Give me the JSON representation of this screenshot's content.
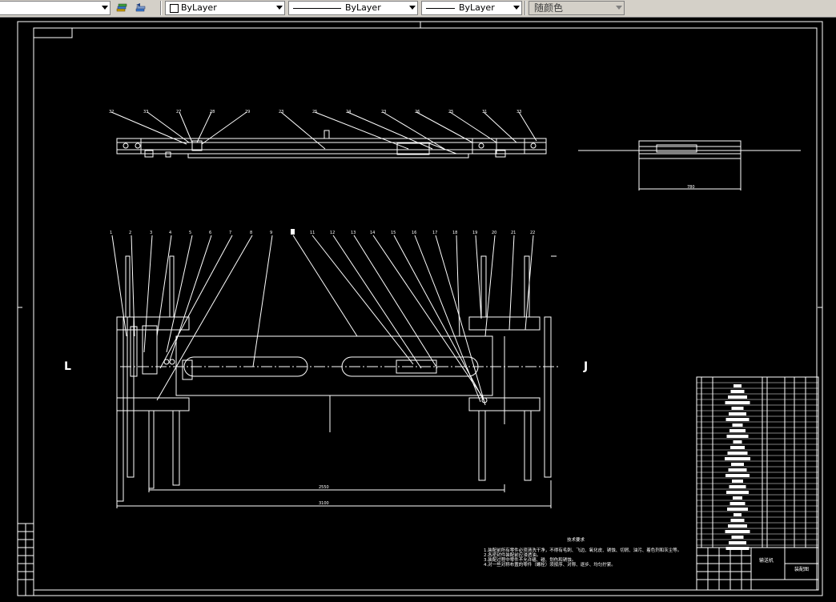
{
  "toolbar": {
    "layer_icon_1": "layer-states-icon",
    "layer_icon_2": "layer-previous-icon",
    "color_combo": "ByLayer",
    "linetype_combo": "ByLayer",
    "lineweight_combo": "ByLayer",
    "plotstyle_combo": "随颜色"
  },
  "drawing": {
    "section_mark_left": "L",
    "section_mark_right": "J",
    "side_view_dimension": "780",
    "plan_dimension_inner": "2550",
    "plan_dimension_outer": "3100",
    "note_title": "技术要求",
    "notes": [
      "1.装配前所有零件必须清洗干净，不得有毛刺、飞边、氧化皮、锈蚀、切屑、油污、着色剂和灰尘等。",
      "2.各密封件装配前应浸透油。",
      "3.装配过程中零件不允许磕、碰、划伤和锈蚀。",
      "4.对一些对称布置的零件（螺栓）须按序、对称、逐步、均匀拧紧。"
    ],
    "title_block_name": "输送机",
    "title_block_sub": "装配图"
  }
}
